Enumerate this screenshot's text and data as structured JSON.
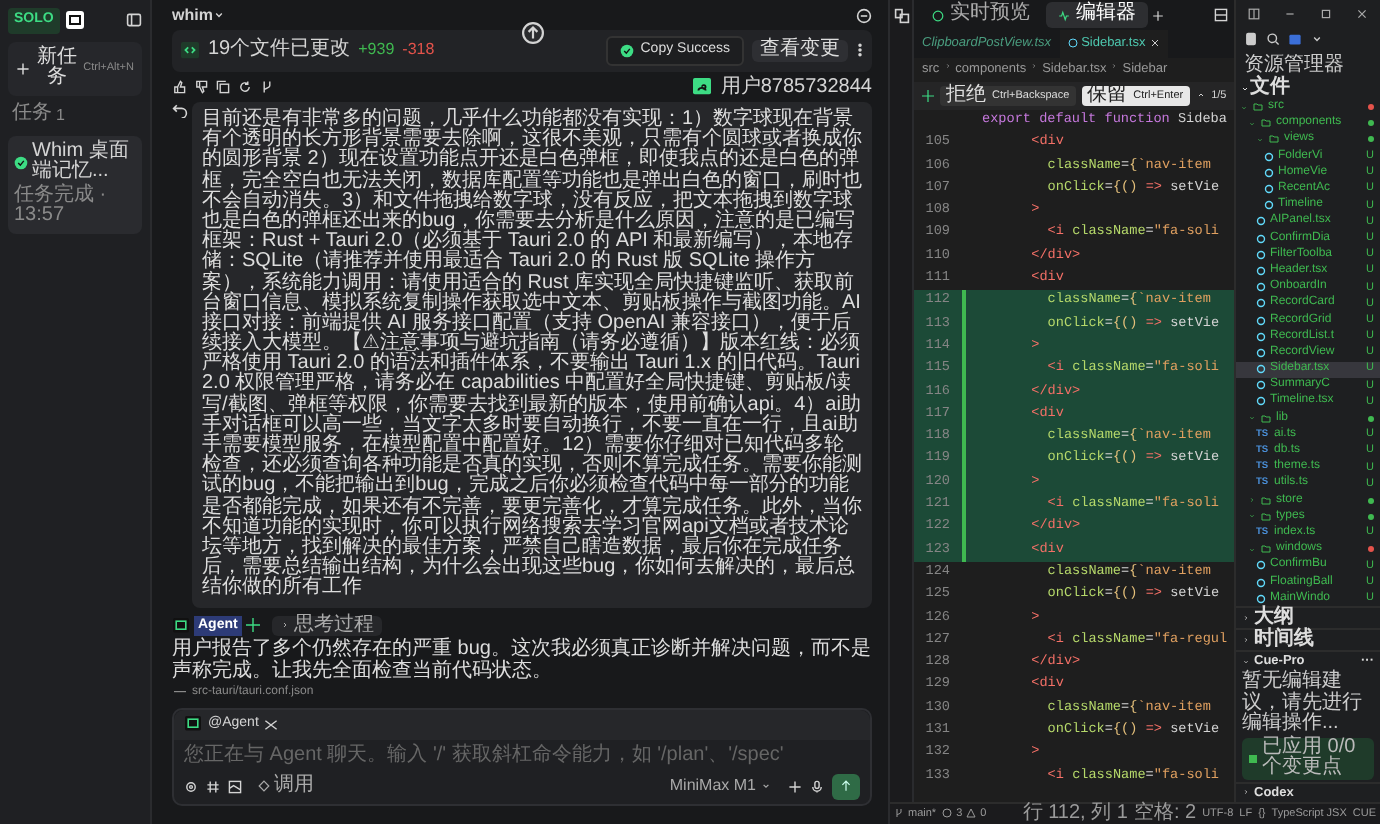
{
  "sidebar": {
    "logo": "SOLO",
    "new_task": {
      "label": "新任务",
      "shortcut": "Ctrl+Alt+N"
    },
    "section": "任务",
    "count": "1",
    "tasks": [
      {
        "title": "Whim 桌面端记忆...",
        "subtitle": "任务完成 · 13:57",
        "selected": true,
        "done": true
      }
    ]
  },
  "chat": {
    "title": "whim",
    "changes": {
      "label": "19个文件已更改",
      "added": "+939",
      "removed": "-318"
    },
    "toast": "Copy Success",
    "review_button": "查看变更",
    "user": "用户8785732844",
    "message": "目前还是有非常多的问题，几乎什么功能都没有实现：1）数字球现在背景有个透明的长方形背景需要去除啊，这很不美观，只需有个圆球或者换成你的圆形背景 2）现在设置功能点开还是白色弹框，即使我点的还是白色的弹框，完全空白也无法关闭，数据库配置等功能也是弹出白色的窗口，刷时也不会自动消失。3）和文件拖拽给数字球，没有反应，把文本拖拽到数字球也是白色的弹框还出来的bug，你需要去分析是什么原因，注意的是已编写框架：Rust + Tauri 2.0（必须基于 Tauri 2.0 的 API 和最新编写），本地存储：SQLite（请推荐并使用最适合 Tauri 2.0 的 Rust 版 SQLite 操作方案），系统能力调用：请使用适合的 Rust 库实现全局快捷键监听、获取前台窗口信息、模拟系统复制操作获取选中文本、剪贴板操作与截图功能。AI 接口对接：前端提供 AI 服务接口配置（支持 OpenAI 兼容接口），便于后续接入大模型。【⚠注意事项与避坑指南（请务必遵循）】版本红线：必须严格使用 Tauri 2.0 的语法和插件体系，不要输出 Tauri 1.x 的旧代码。Tauri 2.0 权限管理严格，请务必在 capabilities 中配置好全局快捷键、剪贴板/读写/截图、弹框等权限，你需要去找到最新的版本，使用前确认api。4）ai助手对话框可以高一些，当文字太多时要自动换行，不要一直在一行，且ai助手需要模型服务，在模型配置中配置好。12）需要你仔细对已知代码多轮检查，还必须查询各种功能是否真的实现，否则不算完成任务。需要你能测试的bug，不能把输出到bug，完成之后你必须检查代码中每一部分的功能是否都能完成，如果还有不完善，要更完善化，才算完成任务。此外，当你不知道功能的实现时，你可以执行网络搜索去学习官网api文档或者技术论坛等地方，找到解决的最佳方案，严禁自己瞎造数据，最后你在完成任务后，需要总结输出结构，为什么会出现这些bug，你如何去解决的，最后总结你做的所有工作",
    "agent": {
      "name": "Agent",
      "thinking": "思考过程",
      "reply": "用户报告了多个仍然存在的严重 bug。这次我必须真正诊断并解决问题，而不是声称完成。让我先全面检查当前代码状态。",
      "file": "src-tauri/tauri.conf.json"
    },
    "composer": {
      "mention": "@Agent",
      "placeholder": "您正在与 Agent 聊天。输入 '/' 获取斜杠命令能力，如 '/plan'、'/spec'",
      "tool_label": "调用",
      "model": "MiniMax M1"
    }
  },
  "editor": {
    "mode_tabs": [
      {
        "label": "实时预览",
        "selected": false
      },
      {
        "label": "编辑器",
        "selected": true
      }
    ],
    "file_tabs": [
      {
        "label": "ClipboardPostView.tsx",
        "selected": false
      },
      {
        "label": "Sidebar.tsx",
        "selected": true
      }
    ],
    "breadcrumb": [
      "src",
      "components",
      "Sidebar.tsx",
      "Sidebar"
    ],
    "diff_bar": {
      "reject": "拒绝",
      "reject_key": "Ctrl+Backspace",
      "accept": "保留",
      "accept_key": "Ctrl+Enter",
      "counter": "1/5"
    },
    "sticky": "export default function Sideba",
    "lines": [
      {
        "number": "105",
        "code": "        <div",
        "added": false
      },
      {
        "number": "106",
        "code": "          className={`nav-item",
        "added": false
      },
      {
        "number": "107",
        "code": "          onClick={() => setVie",
        "added": false
      },
      {
        "number": "108",
        "code": "        >",
        "added": false
      },
      {
        "number": "109",
        "code": "          <i className=\"fa-soli",
        "added": false
      },
      {
        "number": "110",
        "code": "        </div>",
        "added": false
      },
      {
        "number": "111",
        "code": "        <div",
        "added": false
      },
      {
        "number": "112",
        "code": "          className={`nav-item",
        "added": true
      },
      {
        "number": "113",
        "code": "          onClick={() => setVie",
        "added": true
      },
      {
        "number": "114",
        "code": "        >",
        "added": true
      },
      {
        "number": "115",
        "code": "          <i className=\"fa-soli",
        "added": true
      },
      {
        "number": "116",
        "code": "        </div>",
        "added": true
      },
      {
        "number": "117",
        "code": "        <div",
        "added": true
      },
      {
        "number": "118",
        "code": "          className={`nav-item",
        "added": true
      },
      {
        "number": "119",
        "code": "          onClick={() => setVie",
        "added": true
      },
      {
        "number": "120",
        "code": "        >",
        "added": true
      },
      {
        "number": "121",
        "code": "          <i className=\"fa-soli",
        "added": true
      },
      {
        "number": "122",
        "code": "        </div>",
        "added": true
      },
      {
        "number": "123",
        "code": "        <div",
        "added": true
      },
      {
        "number": "124",
        "code": "          className={`nav-item",
        "added": false
      },
      {
        "number": "125",
        "code": "          onClick={() => setVie",
        "added": false
      },
      {
        "number": "126",
        "code": "        >",
        "added": false
      },
      {
        "number": "127",
        "code": "          <i className=\"fa-regul",
        "added": false
      },
      {
        "number": "128",
        "code": "        </div>",
        "added": false
      },
      {
        "number": "129",
        "code": "        <div",
        "added": false
      },
      {
        "number": "130",
        "code": "          className={`nav-item",
        "added": false
      },
      {
        "number": "131",
        "code": "          onClick={() => setVie",
        "added": false
      },
      {
        "number": "132",
        "code": "        >",
        "added": false
      },
      {
        "number": "133",
        "code": "          <i className=\"fa-soli",
        "added": false
      }
    ]
  },
  "explorer": {
    "title": "资源管理器",
    "section": "文件",
    "tree": [
      {
        "name": "src",
        "kind": "folder",
        "expanded": true,
        "color": "#e5534b",
        "children": [
          {
            "name": "components",
            "kind": "folder",
            "expanded": true,
            "color": "#3fb950",
            "children": [
              {
                "name": "views",
                "kind": "folder",
                "expanded": true,
                "color": "#3fb950",
                "children": [
                  {
                    "name": "FolderVi",
                    "kind": "tsx",
                    "status": "U"
                  },
                  {
                    "name": "HomeVie",
                    "kind": "tsx",
                    "status": "U"
                  },
                  {
                    "name": "RecentAc",
                    "kind": "tsx",
                    "status": "U"
                  },
                  {
                    "name": "Timeline",
                    "kind": "tsx",
                    "status": "U"
                  }
                ]
              },
              {
                "name": "AIPanel.tsx",
                "kind": "tsx",
                "status": "U"
              },
              {
                "name": "ConfirmDia",
                "kind": "tsx",
                "status": "U"
              },
              {
                "name": "FilterToolba",
                "kind": "tsx",
                "status": "U"
              },
              {
                "name": "Header.tsx",
                "kind": "tsx",
                "status": "U"
              },
              {
                "name": "OnboardIn",
                "kind": "tsx",
                "status": "U"
              },
              {
                "name": "RecordCard",
                "kind": "tsx",
                "status": "U"
              },
              {
                "name": "RecordGrid",
                "kind": "tsx",
                "status": "U"
              },
              {
                "name": "RecordList.t",
                "kind": "tsx",
                "status": "U"
              },
              {
                "name": "RecordView",
                "kind": "tsx",
                "status": "U"
              },
              {
                "name": "Sidebar.tsx",
                "kind": "tsx",
                "status": "U",
                "selected": true
              },
              {
                "name": "SummaryC",
                "kind": "tsx",
                "status": "U"
              },
              {
                "name": "Timeline.tsx",
                "kind": "tsx",
                "status": "U"
              }
            ]
          },
          {
            "name": "lib",
            "kind": "folder",
            "expanded": true,
            "color": "#3fb950",
            "children": [
              {
                "name": "ai.ts",
                "kind": "ts",
                "icon_text": "TS",
                "status": "U"
              },
              {
                "name": "db.ts",
                "kind": "ts",
                "icon_text": "TS",
                "status": "U"
              },
              {
                "name": "theme.ts",
                "kind": "ts",
                "icon_text": "TS",
                "status": "U"
              },
              {
                "name": "utils.ts",
                "kind": "ts",
                "icon_text": "TS",
                "status": "U"
              }
            ]
          },
          {
            "name": "store",
            "kind": "folder",
            "expanded": false,
            "color": "#3fb950"
          },
          {
            "name": "types",
            "kind": "folder",
            "expanded": true,
            "color": "#3fb950",
            "children": [
              {
                "name": "index.ts",
                "kind": "ts",
                "icon_text": "TS",
                "status": "U"
              }
            ]
          },
          {
            "name": "windows",
            "kind": "folder",
            "expanded": true,
            "color": "#e5534b",
            "children": [
              {
                "name": "ConfirmBu",
                "kind": "tsx",
                "status": "U"
              },
              {
                "name": "FloatingBall",
                "kind": "tsx",
                "status": "U"
              },
              {
                "name": "MainWindo",
                "kind": "tsx",
                "status": "U"
              }
            ]
          }
        ]
      }
    ],
    "panels": [
      {
        "title": "大纲",
        "expanded": false
      },
      {
        "title": "时间线",
        "expanded": false
      },
      {
        "title": "Cue-Pro",
        "expanded": true,
        "more": "···",
        "text": "暂无编辑建议，请先进行编辑操作...",
        "button": "已应用 0/0 个变更点"
      },
      {
        "title": "Codex",
        "expanded": false
      }
    ]
  },
  "status_bar": {
    "branch": "main*",
    "errors": "3",
    "warnings": "0",
    "position": "行 112, 列 1",
    "indent": "空格: 2",
    "encoding": "UTF-8",
    "eol": "LF",
    "braces": "{}",
    "language": "TypeScript JSX",
    "extension": "CUE"
  }
}
